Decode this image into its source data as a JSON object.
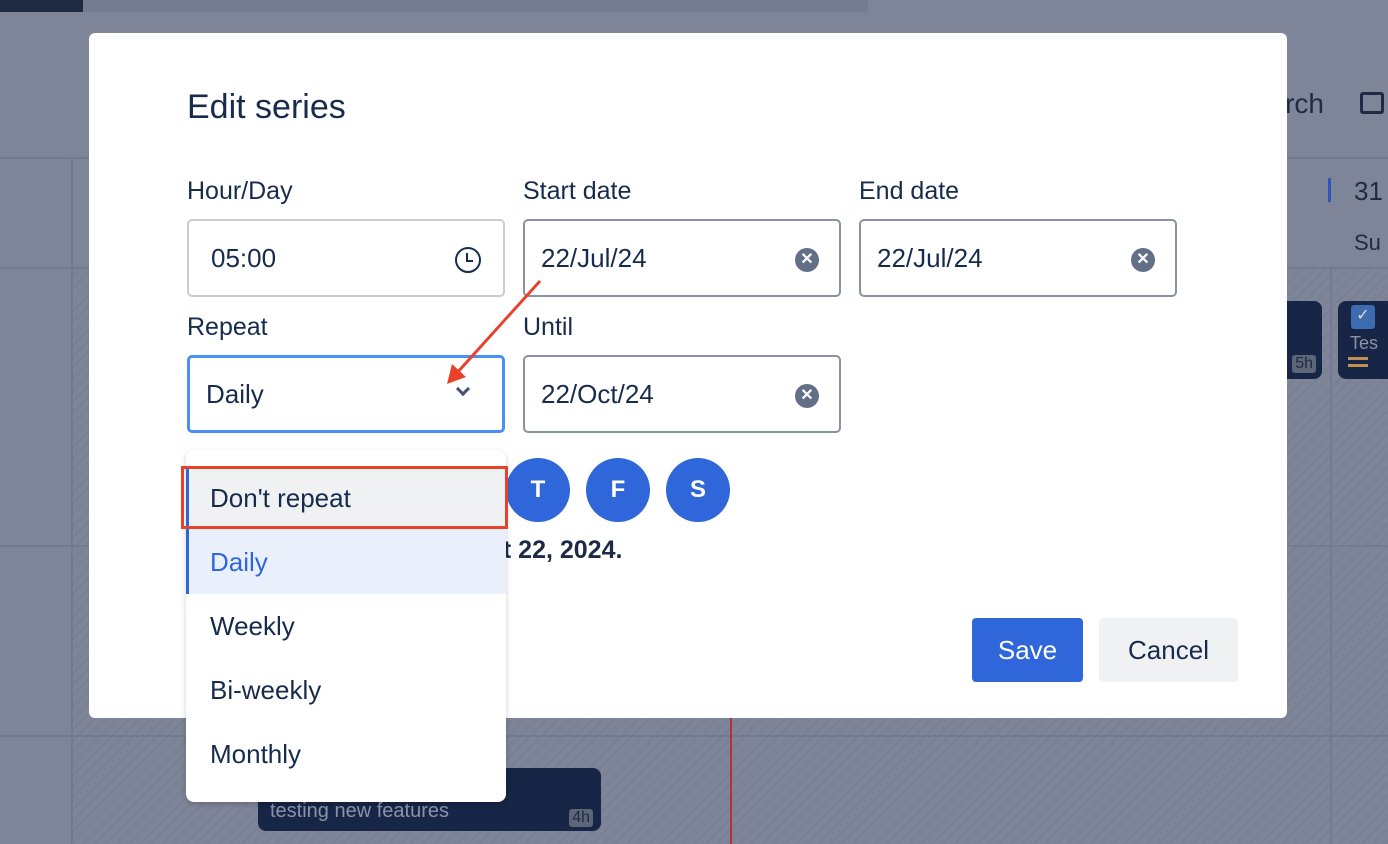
{
  "background": {
    "header_partial": "rch",
    "date_number": "31",
    "day_label": "Su",
    "event_duration_1": "5h",
    "event_title_2": "Tes",
    "event_duration_3": "4h",
    "event_desc_3": "testing new features"
  },
  "modal": {
    "title": "Edit series",
    "hour_label": "Hour/Day",
    "hour_value": "05:00",
    "start_label": "Start date",
    "start_value": "22/Jul/24",
    "end_label": "End date",
    "end_value": "22/Jul/24",
    "repeat_label": "Repeat",
    "repeat_value": "Daily",
    "until_label": "Until",
    "until_value": "22/Oct/24",
    "days": [
      "T",
      "F",
      "S"
    ],
    "summary_partial": "ct 22, 2024.",
    "save": "Save",
    "cancel": "Cancel"
  },
  "dropdown": {
    "options": [
      "Don't repeat",
      "Daily",
      "Weekly",
      "Bi-weekly",
      "Monthly"
    ],
    "selected": "Daily",
    "highlighted": "Don't repeat"
  },
  "colors": {
    "accent": "#2f67da",
    "annotation": "#e8412c"
  }
}
